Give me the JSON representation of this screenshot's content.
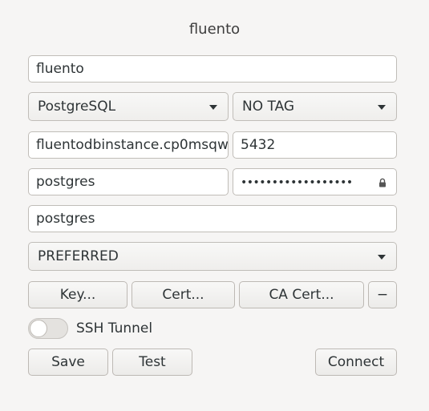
{
  "window": {
    "title": "fluento"
  },
  "form": {
    "name_value": "fluento",
    "driver_select": "PostgreSQL",
    "tag_select": "NO TAG",
    "host_value": "fluentodbinstance.cp0msqw",
    "port_value": "5432",
    "user_value": "postgres",
    "password_masked": "••••••••••••••••••",
    "database_value": "postgres",
    "ssl_mode_select": "PREFERRED"
  },
  "ssl_buttons": {
    "key_label": "Key...",
    "cert_label": "Cert...",
    "ca_cert_label": "CA Cert...",
    "remove_label": "−"
  },
  "ssh": {
    "label": "SSH Tunnel",
    "enabled": false
  },
  "actions": {
    "save_label": "Save",
    "test_label": "Test",
    "connect_label": "Connect"
  }
}
